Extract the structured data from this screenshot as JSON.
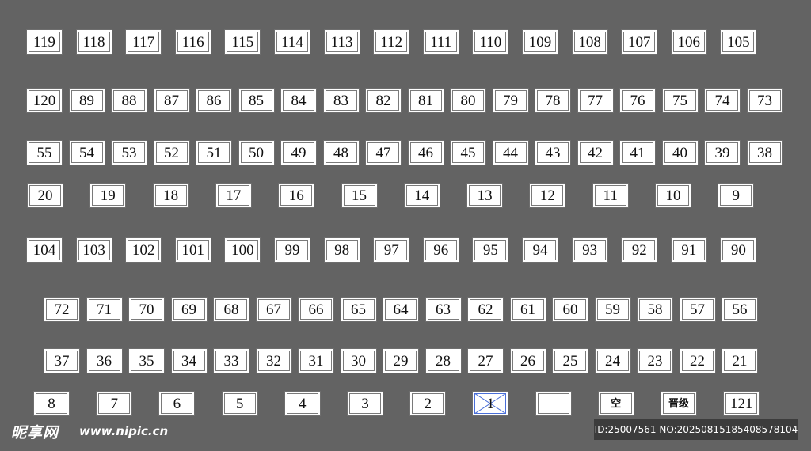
{
  "rows": [
    [
      "119",
      "118",
      "117",
      "116",
      "115",
      "114",
      "113",
      "112",
      "111",
      "110",
      "109",
      "108",
      "107",
      "106",
      "105"
    ],
    [
      "120",
      "89",
      "88",
      "87",
      "86",
      "85",
      "84",
      "83",
      "82",
      "81",
      "80",
      "79",
      "78",
      "77",
      "76",
      "75",
      "74",
      "73"
    ],
    [
      "55",
      "54",
      "53",
      "52",
      "51",
      "50",
      "49",
      "48",
      "47",
      "46",
      "45",
      "44",
      "43",
      "42",
      "41",
      "40",
      "39",
      "38"
    ],
    [
      "20",
      "19",
      "18",
      "17",
      "16",
      "15",
      "14",
      "13",
      "12",
      "11",
      "10",
      "9"
    ],
    [
      "104",
      "103",
      "102",
      "101",
      "100",
      "99",
      "98",
      "97",
      "96",
      "95",
      "94",
      "93",
      "92",
      "91",
      "90"
    ],
    [
      "72",
      "71",
      "70",
      "69",
      "68",
      "67",
      "66",
      "65",
      "64",
      "63",
      "62",
      "61",
      "60",
      "59",
      "58",
      "57",
      "56"
    ],
    [
      "37",
      "36",
      "35",
      "34",
      "33",
      "32",
      "31",
      "30",
      "29",
      "28",
      "27",
      "26",
      "25",
      "24",
      "23",
      "22",
      "21"
    ],
    [
      "8",
      "7",
      "6",
      "5",
      "4",
      "3",
      "2",
      "1",
      "",
      "空",
      "晋级",
      "121"
    ]
  ],
  "selected_label": "1",
  "watermark": {
    "logo": "昵享网",
    "site": "www.nipic.cn",
    "id_text": "ID:25007561 NO:20250815185408578104"
  }
}
